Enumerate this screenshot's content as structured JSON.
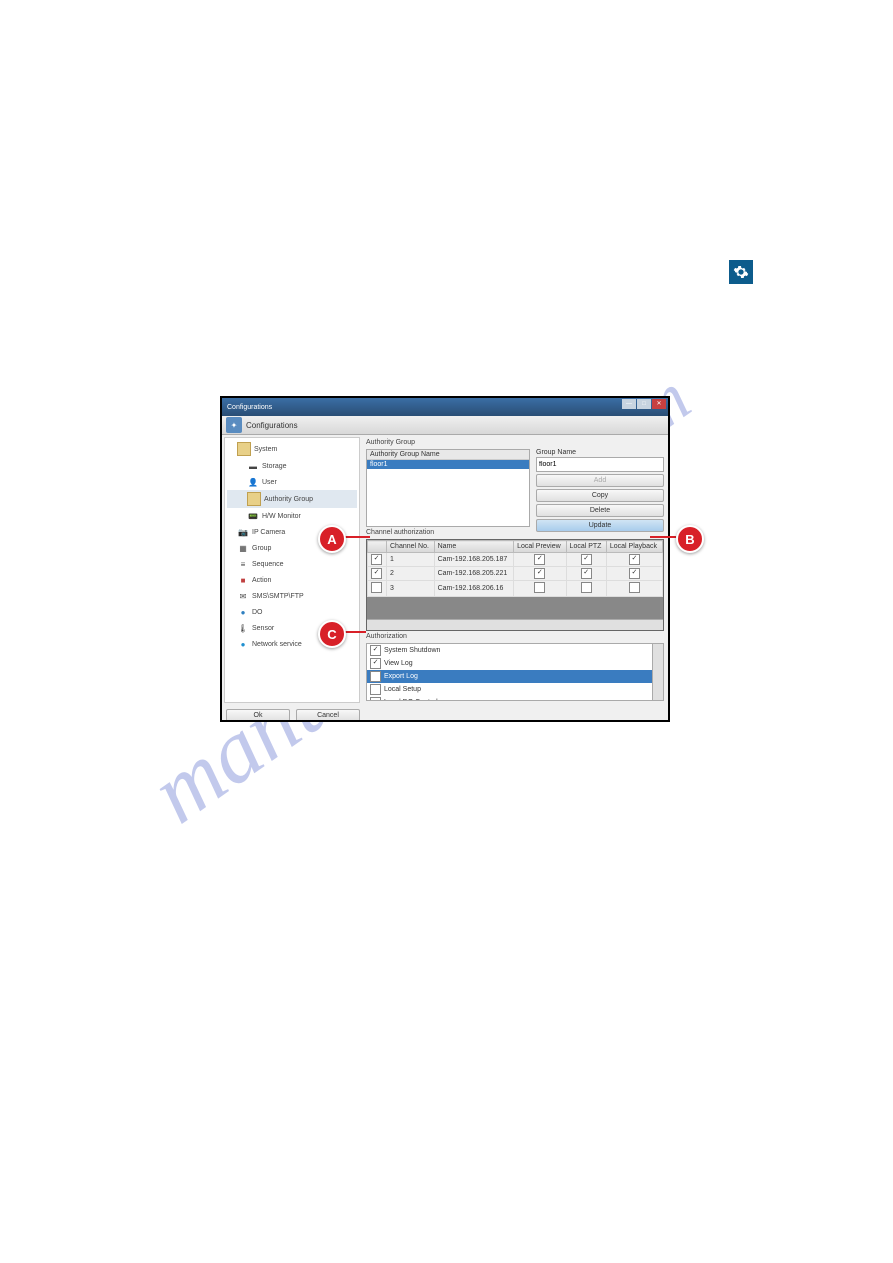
{
  "gear": "gear-icon",
  "window": {
    "title": "Configurations",
    "toolbar_label": "Configurations"
  },
  "sidebar": {
    "items": [
      {
        "label": "System",
        "level": 1,
        "icon": "box"
      },
      {
        "label": "Storage",
        "level": 2,
        "icon": "disk"
      },
      {
        "label": "User",
        "level": 2,
        "icon": "user"
      },
      {
        "label": "Authority Group",
        "level": 2,
        "icon": "group",
        "selected": true
      },
      {
        "label": "H/W Monitor",
        "level": 2,
        "icon": "monitor"
      },
      {
        "label": "IP Camera",
        "level": 1,
        "icon": "camera"
      },
      {
        "label": "Group",
        "level": 1,
        "icon": "group2"
      },
      {
        "label": "Sequence",
        "level": 1,
        "icon": "seq"
      },
      {
        "label": "Action",
        "level": 1,
        "icon": "action"
      },
      {
        "label": "SMS\\SMTP\\FTP",
        "level": 1,
        "icon": "mail"
      },
      {
        "label": "DO",
        "level": 1,
        "icon": "do"
      },
      {
        "label": "Sensor",
        "level": 1,
        "icon": "sensor"
      },
      {
        "label": "Network service",
        "level": 1,
        "icon": "net"
      }
    ]
  },
  "authgroup": {
    "section": "Authority Group",
    "header": "Authority Group Name",
    "item": "floor1",
    "groupname_label": "Group Name",
    "groupname_value": "floor1",
    "btn_add": "Add",
    "btn_copy": "Copy",
    "btn_delete": "Delete",
    "btn_update": "Update"
  },
  "channel": {
    "section": "Channel authorization",
    "headers": [
      "",
      "Channel No.",
      "Name",
      "Local Preview",
      "Local PTZ",
      "Local Playback"
    ],
    "rows": [
      {
        "chk": true,
        "no": "1",
        "name": "Cam-192.168.205.187",
        "c1": true,
        "c2": true,
        "c3": true
      },
      {
        "chk": true,
        "no": "2",
        "name": "Cam-192.168.205.221",
        "c1": true,
        "c2": true,
        "c3": true
      },
      {
        "chk": false,
        "no": "3",
        "name": "Cam-192.168.206.16",
        "c1": false,
        "c2": false,
        "c3": false
      }
    ]
  },
  "auth": {
    "section": "Authorization",
    "items": [
      {
        "chk": true,
        "label": "System Shutdown"
      },
      {
        "chk": true,
        "label": "View Log"
      },
      {
        "chk": true,
        "label": "Export Log",
        "selected": true
      },
      {
        "chk": false,
        "label": "Local Setup"
      },
      {
        "chk": false,
        "label": "Local DO Control"
      }
    ]
  },
  "buttons": {
    "ok": "Ok",
    "cancel": "Cancel"
  },
  "callouts": {
    "a": "A",
    "b": "B",
    "c": "C"
  },
  "watermark": "manualshive.com"
}
